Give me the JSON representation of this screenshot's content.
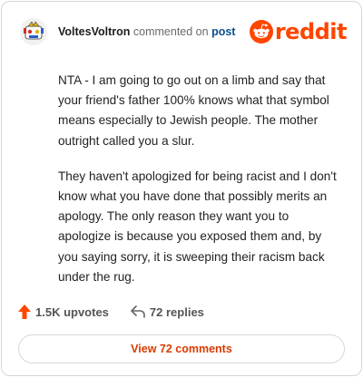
{
  "header": {
    "username": "VoltesVoltron",
    "action": "commented on",
    "post_link": "post",
    "logo_text": "reddit",
    "avatar_icon": "user-avatar-icon",
    "logo_icon": "reddit-snoo-icon"
  },
  "comment": {
    "paragraphs": [
      "NTA - I am going to go out on a limb and say that your friend's father 100% knows what that symbol means especially to Jewish people. The mother outright called you a slur.",
      "They haven't apologized for being racist and I don't know what you have done that possibly merits an apology. The only reason they want you to apologize is because you exposed them and, by you saying sorry, it is sweeping their racism back under the rug."
    ]
  },
  "stats": {
    "upvotes": "1.5K upvotes",
    "replies": "72 replies"
  },
  "footer": {
    "view_comments": "View 72 comments"
  },
  "colors": {
    "brand": "#ff4500",
    "link": "#0a4f8c",
    "button_text": "#d93a00"
  }
}
